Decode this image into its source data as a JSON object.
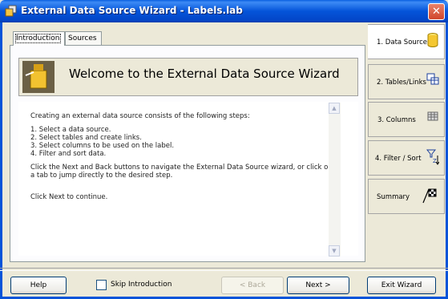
{
  "window": {
    "title": "External Data Source Wizard - Labels.lab",
    "close_glyph": "✕"
  },
  "tabs": [
    {
      "label": "Introduction"
    },
    {
      "label": "Sources"
    }
  ],
  "banner": {
    "title": "Welcome to the External Data Source Wizard"
  },
  "content": {
    "lines": [
      "Creating an external data source consists of the following steps:",
      "",
      "1. Select a data source.",
      "2. Select tables and create links.",
      "3. Select columns to be used on the label.",
      "4. Filter and sort data.",
      "",
      "Click the Next and Back buttons to navigate the External Data Source wizard, or click on a tab to jump directly to the desired step.",
      "",
      "Click Next to continue."
    ]
  },
  "steps": [
    {
      "label": "1. Data Source",
      "icon": "database-icon",
      "active": true
    },
    {
      "label": "2. Tables/Links",
      "icon": "tables-icon",
      "active": false
    },
    {
      "label": "3. Columns",
      "icon": "columns-icon",
      "active": false
    },
    {
      "label": "4. Filter / Sort",
      "icon": "filter-sort-icon",
      "active": false
    },
    {
      "label": "Summary",
      "icon": "checkered-flag-icon",
      "active": false
    }
  ],
  "footer": {
    "help": "Help",
    "skip_intro": "Skip Introduction",
    "skip_checked": false,
    "back": "< Back",
    "next": "Next >",
    "exit": "Exit Wizard"
  }
}
